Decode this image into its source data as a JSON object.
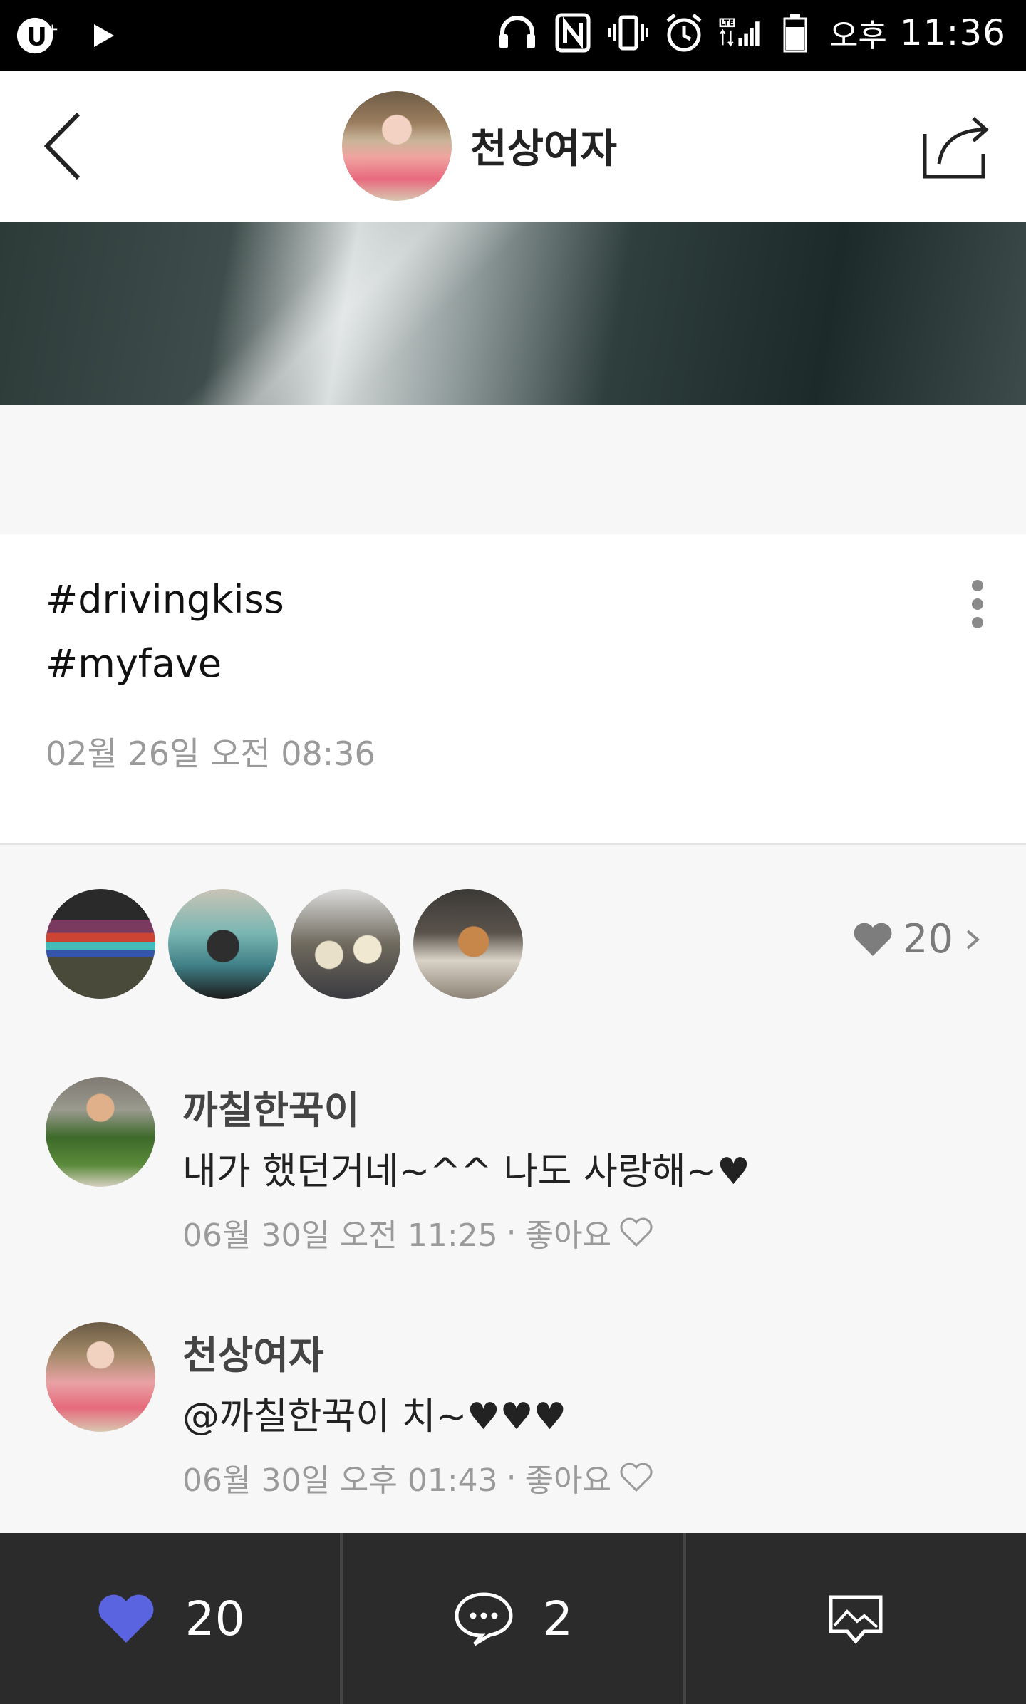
{
  "status_bar": {
    "ampm": "오후",
    "time": "11:36"
  },
  "header": {
    "title": "천상여자"
  },
  "post": {
    "tags": [
      "#drivingkiss",
      "#myfave"
    ],
    "timestamp": "02월 26일 오전 08:36"
  },
  "likes": {
    "count": "20"
  },
  "comments": [
    {
      "author": "까칠한꾹이",
      "text": "내가 했던거네~^^ 나도 사랑해~♥",
      "timestamp": "06월 30일 오전 11:25",
      "like_label": "좋아요"
    },
    {
      "author": "천상여자",
      "text": "@까칠한꾹이 치~♥♥♥",
      "timestamp": "06월 30일 오후 01:43",
      "like_label": "좋아요"
    }
  ],
  "bottom_bar": {
    "like_count": "20",
    "comment_count": "2"
  },
  "colors": {
    "accent_heart": "#5a63e0",
    "bar_background": "#2b2b2b"
  }
}
